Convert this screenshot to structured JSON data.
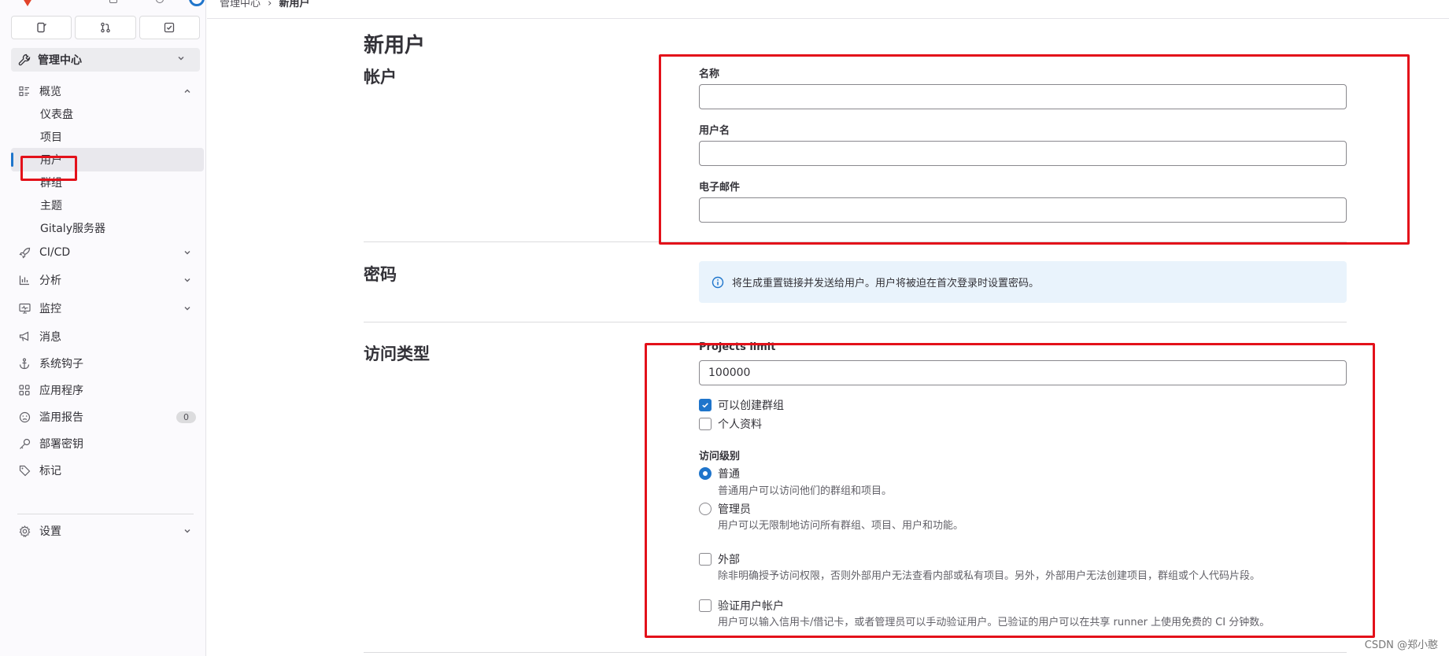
{
  "breadcrumb": {
    "parent": "管理中心",
    "separator": "›",
    "current": "新用户"
  },
  "sidebar": {
    "top_tabs": [
      {
        "icon": "issues-icon"
      },
      {
        "icon": "merge-request-icon"
      },
      {
        "icon": "todo-icon"
      }
    ],
    "context": {
      "label": "管理中心",
      "icon": "admin-wrench-icon"
    },
    "overview": {
      "label": "概览",
      "icon": "overview-icon"
    },
    "overview_items": [
      "仪表盘",
      "项目",
      "用户",
      "群组",
      "主题",
      "Gitaly服务器"
    ],
    "active_item": "用户",
    "items": [
      {
        "label": "CI/CD",
        "icon": "rocket-icon",
        "has_chevron": true
      },
      {
        "label": "分析",
        "icon": "chart-icon",
        "has_chevron": true
      },
      {
        "label": "监控",
        "icon": "monitor-icon",
        "has_chevron": true
      },
      {
        "label": "消息",
        "icon": "bullhorn-icon",
        "has_chevron": false
      },
      {
        "label": "系统钩子",
        "icon": "anchor-icon",
        "has_chevron": false
      },
      {
        "label": "应用程序",
        "icon": "apps-icon",
        "has_chevron": false
      },
      {
        "label": "滥用报告",
        "icon": "slight-frown-icon",
        "has_chevron": false,
        "badge": "0"
      },
      {
        "label": "部署密钥",
        "icon": "key-icon",
        "has_chevron": false
      },
      {
        "label": "标记",
        "icon": "label-icon",
        "has_chevron": false
      }
    ],
    "settings": {
      "label": "设置",
      "icon": "settings-icon"
    }
  },
  "main": {
    "page_title": "新用户",
    "account": {
      "title": "帐户",
      "name_label": "名称",
      "name_value": "",
      "username_label": "用户名",
      "username_value": "",
      "email_label": "电子邮件",
      "email_value": ""
    },
    "password": {
      "title": "密码",
      "info": "将生成重置链接并发送给用户。用户将被迫在首次登录时设置密码。"
    },
    "access": {
      "title": "访问类型",
      "projects_limit_label": "Projects limit",
      "projects_limit_value": "100000",
      "can_create_group_label": "可以创建群组",
      "can_create_group_checked": true,
      "private_profile_label": "个人资料",
      "private_profile_checked": false,
      "access_level_label": "访问级别",
      "regular_label": "普通",
      "regular_help": "普通用户可以访问他们的群组和项目。",
      "regular_selected": true,
      "admin_label": "管理员",
      "admin_help": "用户可以无限制地访问所有群组、项目、用户和功能。",
      "admin_selected": false,
      "external_label": "外部",
      "external_help": "除非明确授予访问权限，否则外部用户无法查看内部或私有项目。另外，外部用户无法创建项目，群组或个人代码片段。",
      "external_checked": false,
      "validate_label": "验证用户帐户",
      "validate_help": "用户可以输入信用卡/借记卡，或者管理员可以手动验证用户。已验证的用户可以在共享 runner 上使用免费的 CI 分钟数。",
      "validate_checked": false
    }
  },
  "watermark": "CSDN @郑小憨",
  "colors": {
    "accent": "#1f75cb",
    "annotation_red": "#e3111a"
  }
}
